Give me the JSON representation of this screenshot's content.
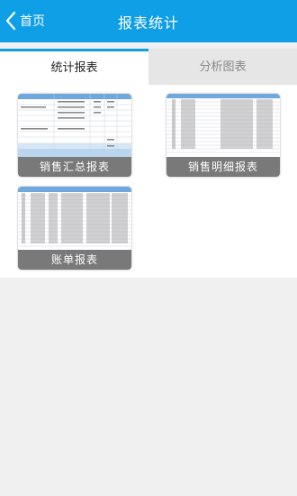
{
  "navbar": {
    "back_label": "首页",
    "title": "报表统计"
  },
  "tabs": [
    {
      "label": "统计报表",
      "active": true
    },
    {
      "label": "分析图表",
      "active": false
    }
  ],
  "reports": [
    {
      "label": "销售汇总报表"
    },
    {
      "label": "销售明细报表"
    },
    {
      "label": "账单报表"
    }
  ],
  "colors": {
    "primary": "#0f9fe6",
    "page_background": "#f0f0f0",
    "inactive_tab": "#e6e6e6",
    "card_label_background": "#6e6e6e"
  }
}
